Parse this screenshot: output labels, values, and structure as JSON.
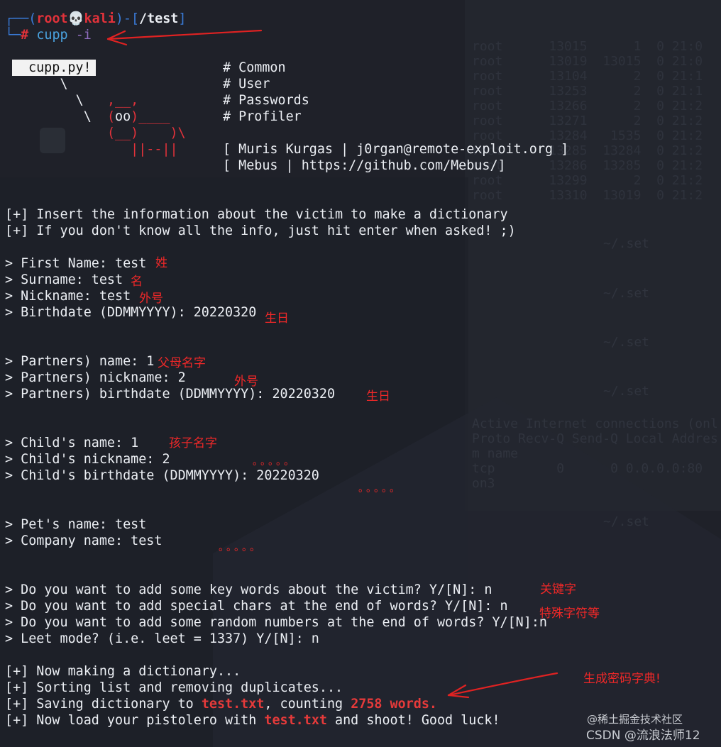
{
  "prompt": {
    "open": "┌──(",
    "user": "root",
    "skull": "💀",
    "host": "kali",
    "mid": ")-[",
    "path": "/test",
    "close": "]",
    "corner": "└─",
    "hash": "#",
    "cmd": "cupp",
    "arg": "-i"
  },
  "logo": {
    "label": "cupp.py!",
    "menu": [
      "# Common",
      "# User",
      "# Passwords",
      "# Profiler"
    ],
    "author1": "[ Muris Kurgas | j0rgan@remote-exploit.org ]",
    "author2": "[ Mebus | https://github.com/Mebus/]"
  },
  "intro": [
    "[+] Insert the information about the victim to make a dictionary",
    "[+] If you don't know all the info, just hit enter when asked! ;)"
  ],
  "victim": [
    "> First Name: test",
    "> Surname: test",
    "> Nickname: test",
    "> Birthdate (DDMMYYYY): 20220320"
  ],
  "partners": [
    "> Partners) name: 1",
    "> Partners) nickname: 2",
    "> Partners) birthdate (DDMMYYYY): 20220320"
  ],
  "child": [
    "> Child's name: 1",
    "> Child's nickname: 2",
    "> Child's birthdate (DDMMYYYY): 20220320"
  ],
  "other": [
    "> Pet's name: test",
    "> Company name: test"
  ],
  "questions": [
    "> Do you want to add some key words about the victim? Y/[N]: n",
    "> Do you want to add special chars at the end of words? Y/[N]: n",
    "> Do you want to add some random numbers at the end of words? Y/[N]:n",
    "> Leet mode? (i.e. leet = 1337) Y/[N]: n"
  ],
  "result": {
    "l1": "[+] Now making a dictionary...",
    "l2": "[+] Sorting list and removing duplicates...",
    "l3a": "[+] Saving dictionary to ",
    "l3file": "test.txt",
    "l3b": ", counting ",
    "l3count": "2758 words.",
    "l4a": "[+] Now load your pistolero with ",
    "l4file": "test.txt",
    "l4b": " and shoot! Good luck!"
  },
  "annotations": {
    "first": "姓",
    "surname": "名",
    "nickname": "外号",
    "birth": "生日",
    "partner_name": "父母名字",
    "partner_nick": "外号",
    "partner_birth": "生日",
    "child_name": "孩子名字",
    "keywords": "关键字",
    "special": "特殊字符等",
    "generate": "生成密码字典!",
    "dots": "。。。。。"
  },
  "watermark": {
    "line1": "@稀土掘金技术社区",
    "line2": "CSDN @流浪法师12"
  },
  "colors": {
    "background": "#1f2129",
    "text": "#eceff4",
    "accent_red": "#e2323a",
    "annotation_red": "#f02828",
    "prompt_blue": "#3a7bd8"
  }
}
